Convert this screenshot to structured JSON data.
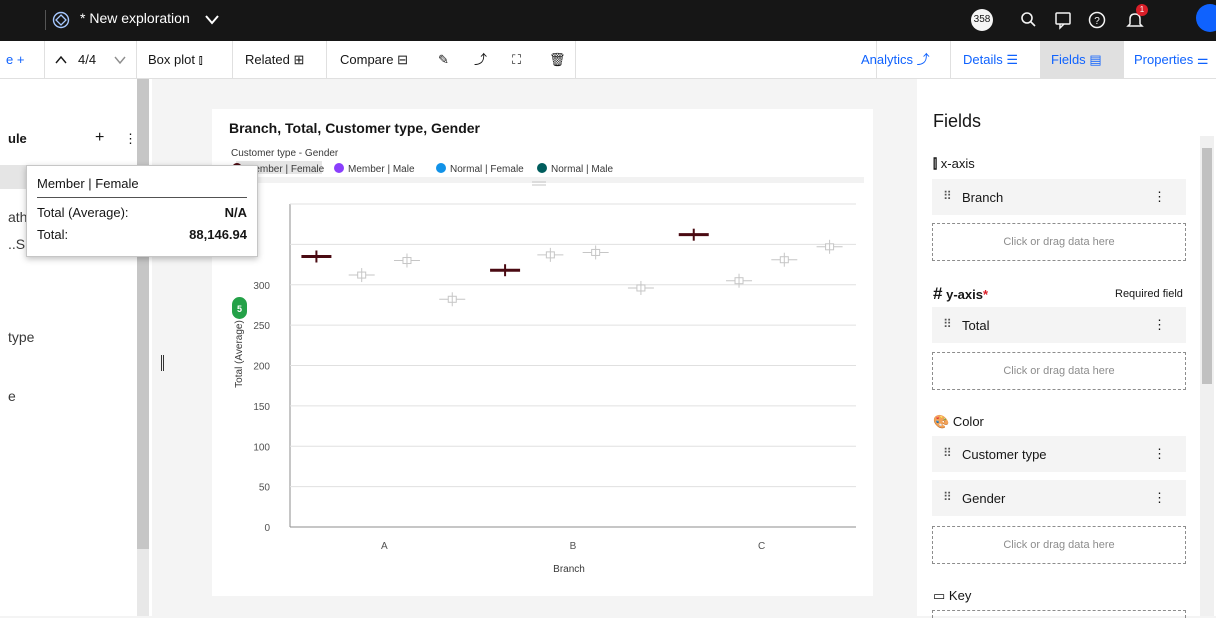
{
  "topbar": {
    "title": "* New exploration",
    "notifications_count": "358",
    "alert_count": "1"
  },
  "toolbar": {
    "left_partial": "e +",
    "counter": "4/4",
    "box_plot": "Box plot",
    "related": "Related",
    "compare": "Compare",
    "analytics": "Analytics",
    "details": "Details",
    "fields": "Fields",
    "properties": "Properties"
  },
  "leftpanel": {
    "heading_partial": "ule",
    "items": [
      "ath",
      "..SI",
      "type",
      "e"
    ]
  },
  "tooltip": {
    "title": "Member | Female",
    "rows": [
      {
        "label": "Total (Average):",
        "value": "N/A"
      },
      {
        "label": "Total:",
        "value": "88,146.94"
      }
    ]
  },
  "chart_data": {
    "type": "boxplot",
    "title": "Branch, Total, Customer type, Gender",
    "legend_title": "Customer type - Gender",
    "legend_position": "top-left",
    "xlabel": "Branch",
    "ylabel": "Total (Average)",
    "categories": [
      "A",
      "B",
      "C"
    ],
    "ylim": [
      0,
      400
    ],
    "yticks": [
      0,
      50,
      100,
      150,
      200,
      250,
      300,
      350,
      400
    ],
    "ytick_labels": [
      "0",
      "50",
      "100",
      "150",
      "200",
      "250",
      "300",
      "",
      ""
    ],
    "grid": true,
    "side_badge": "5",
    "series": [
      {
        "name": "Member | Female",
        "color": "#4a0a12",
        "highlighted": true,
        "values": [
          335,
          318,
          362
        ]
      },
      {
        "name": "Member | Male",
        "color": "#8a3ffc",
        "highlighted": false,
        "values": [
          312,
          337,
          305
        ]
      },
      {
        "name": "Normal | Female",
        "color": "#1192e8",
        "highlighted": false,
        "values": [
          330,
          340,
          331
        ]
      },
      {
        "name": "Normal | Male",
        "color": "#005d5d",
        "highlighted": false,
        "values": [
          282,
          296,
          347
        ]
      }
    ]
  },
  "fields_panel": {
    "title": "Fields",
    "xaxis_label": "x-axis",
    "xaxis_field": "Branch",
    "yaxis_label": "y-axis",
    "yaxis_required_mark": "*",
    "required_text": "Required field",
    "yaxis_field": "Total",
    "color_label": "Color",
    "color_fields": [
      "Customer type",
      "Gender"
    ],
    "key_label": "Key",
    "drop_placeholder": "Click or drag data here"
  },
  "colors": {
    "brand_blue": "#0f62fe",
    "topbar_bg": "#161616",
    "badge_green": "#24a148"
  }
}
